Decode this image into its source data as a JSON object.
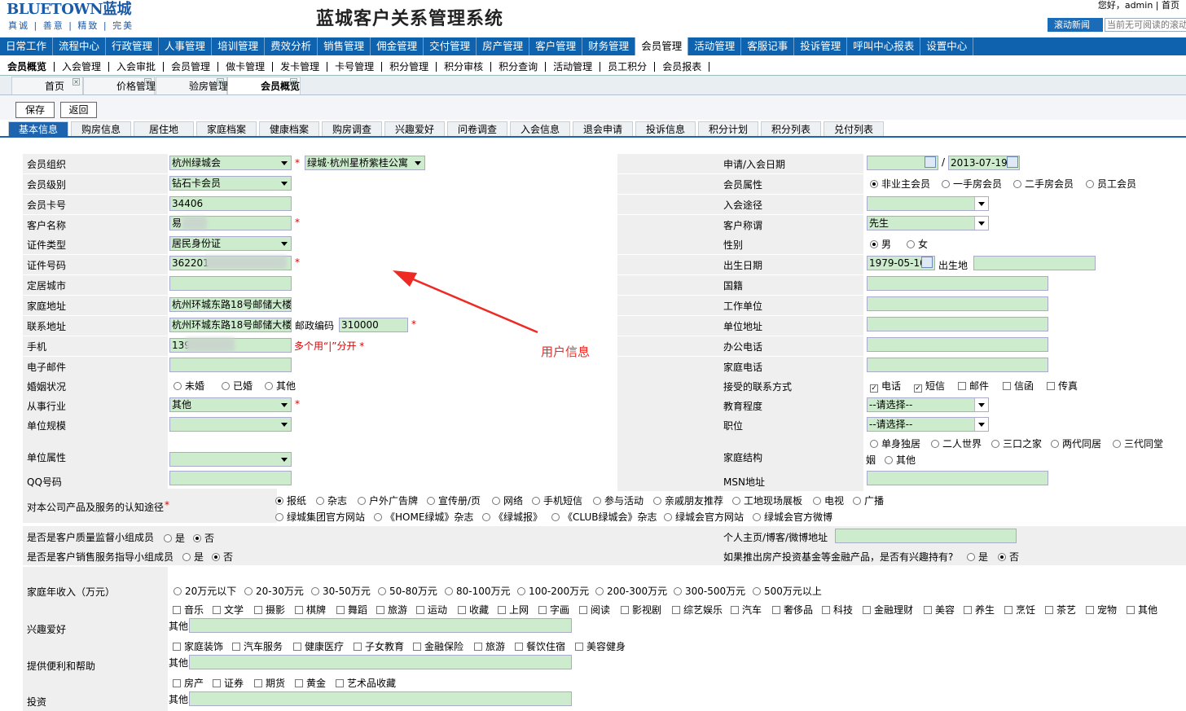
{
  "header": {
    "logo_en": "BLUETOWN蓝城",
    "logo_tagline": "真诚 | 善意 | 精致 | 完美",
    "title": "蓝城客户关系管理系统",
    "greeting": "您好，admin",
    "home_link": "首页",
    "news_label": "滚动新闻",
    "news_text": "当前无可阅读的滚动"
  },
  "main_nav": [
    "日常工作",
    "流程中心",
    "行政管理",
    "人事管理",
    "培训管理",
    "费效分析",
    "销售管理",
    "佣金管理",
    "交付管理",
    "房产管理",
    "客户管理",
    "财务管理",
    "会员管理",
    "活动管理",
    "客服记事",
    "投诉管理",
    "呼叫中心报表",
    "设置中心"
  ],
  "main_nav_active": "会员管理",
  "sub_nav": [
    "会员概览",
    "入会管理",
    "入会审批",
    "会员管理",
    "做卡管理",
    "发卡管理",
    "卡号管理",
    "积分管理",
    "积分审核",
    "积分查询",
    "活动管理",
    "员工积分",
    "会员报表"
  ],
  "sub_nav_active": "会员概览",
  "page_tabs": [
    "首页",
    "价格管理",
    "验房管理",
    "会员概览"
  ],
  "close_glyph": "×",
  "toolbar": {
    "save": "保存",
    "back": "返回"
  },
  "form_tabs": [
    "基本信息",
    "购房信息",
    "居住地",
    "家庭档案",
    "健康档案",
    "购房调查",
    "兴趣爱好",
    "问卷调查",
    "入会信息",
    "退会申请",
    "投诉信息",
    "积分计划",
    "积分列表",
    "兑付列表"
  ],
  "form_tabs_active": "基本信息",
  "form": {
    "org_label": "会员组织",
    "org_value": "杭州绿城会",
    "project_value": "绿城·杭州星桥紫桂公寓",
    "level_label": "会员级别",
    "level_value": "钻石卡会员",
    "card_label": "会员卡号",
    "card_value": "34406",
    "name_label": "客户名称",
    "name_value": "易",
    "idtype_label": "证件类型",
    "idtype_value": "居民身份证",
    "idno_label": "证件号码",
    "idno_value": "362201",
    "city_label": "定居城市",
    "home_addr_label": "家庭地址",
    "home_addr_value": "杭州环城东路18号邮储大楼",
    "contact_addr_label": "联系地址",
    "contact_addr_value": "杭州环城东路18号邮储大楼",
    "zip_label": "邮政编码",
    "zip_value": "310000",
    "mobile_label": "手机",
    "mobile_value": "139",
    "mobile_hint": "多个用“|”分开 *",
    "email_label": "电子邮件",
    "marital_label": "婚姻状况",
    "marital_options": [
      "未婚",
      "已婚",
      "其他"
    ],
    "industry_label": "从事行业",
    "industry_value": "其他",
    "scale_label": "单位规模",
    "attr_label": "单位属性",
    "qq_label": "QQ号码",
    "apply_date_label": "申请/入会日期",
    "apply_date_sep": "/",
    "apply_date_value": "2013-07-19",
    "member_attr_label": "会员属性",
    "member_attr_options": [
      "非业主会员",
      "一手房会员",
      "二手房会员",
      "员工会员"
    ],
    "join_way_label": "入会途径",
    "salutation_label": "客户称谓",
    "salutation_value": "先生",
    "gender_label": "性别",
    "gender_options": [
      "男",
      "女"
    ],
    "birth_label": "出生日期",
    "birth_value": "1979-05-10",
    "birthplace_label": "出生地",
    "nationality_label": "国籍",
    "employer_label": "工作单位",
    "employer_addr_label": "单位地址",
    "office_phone_label": "办公电话",
    "home_phone_label": "家庭电话",
    "contact_way_label": "接受的联系方式",
    "contact_way_options": [
      "电话",
      "短信",
      "邮件",
      "信函",
      "传真"
    ],
    "edu_label": "教育程度",
    "edu_value": "--请选择--",
    "position_label": "职位",
    "position_value": "--请选择--",
    "family_label": "家庭结构",
    "family_options": [
      "单身独居",
      "二人世界",
      "三口之家",
      "两代同居",
      "三代同堂",
      "其他"
    ],
    "family_wrap": "姻",
    "msn_label": "MSN地址",
    "awareness_label": "对本公司产品及服务的认知途径",
    "awareness_options_1": [
      "报纸",
      "杂志",
      "户外广告牌",
      "宣传册/页",
      "网络",
      "手机短信",
      "参与活动",
      "亲戚朋友推荐",
      "工地现场展板",
      "电视",
      "广播"
    ],
    "awareness_options_2": [
      "绿城集团官方网站",
      "《HOME绿城》杂志",
      "《绿城报》",
      "《CLUB绿城会》杂志",
      "绿城会官方网站",
      "绿城会官方微博"
    ],
    "quality_label": "是否是客户质量监督小组成员",
    "sales_label": "是否是客户销售服务指导小组成员",
    "yes": "是",
    "no": "否",
    "homepage_label": "个人主页/博客/微博地址",
    "fund_label": "如果推出房产投资基金等金融产品，是否有兴趣持有?",
    "income_label": "家庭年收入（万元）",
    "income_options": [
      "20万元以下",
      "20-30万元",
      "30-50万元",
      "50-80万元",
      "80-100万元",
      "100-200万元",
      "200-300万元",
      "300-500万元",
      "500万元以上"
    ],
    "hobby_label": "兴趣爱好",
    "hobby_options": [
      "音乐",
      "文学",
      "摄影",
      "棋牌",
      "舞蹈",
      "旅游",
      "运动",
      "收藏",
      "上网",
      "字画",
      "阅读",
      "影视剧",
      "综艺娱乐",
      "汽车",
      "奢侈品",
      "科技",
      "金融理财",
      "美容",
      "养生",
      "烹饪",
      "茶艺",
      "宠物",
      "其他"
    ],
    "other_label": "其他",
    "help_label": "提供便利和帮助",
    "help_options": [
      "家庭装饰",
      "汽车服务",
      "健康医疗",
      "子女教育",
      "金融保险",
      "旅游",
      "餐饮住宿",
      "美容健身"
    ],
    "invest_label": "投资",
    "invest_options": [
      "房产",
      "证券",
      "期货",
      "黄金",
      "艺术品收藏"
    ]
  },
  "annotation": {
    "text": "用户信息",
    "color": "#ee2a24"
  }
}
